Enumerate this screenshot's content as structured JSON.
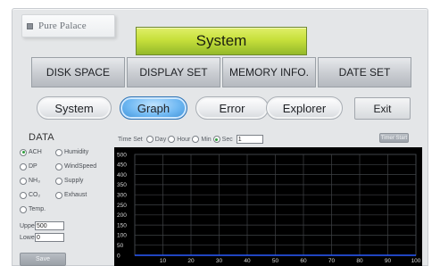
{
  "brand": {
    "name": "Pure Palace"
  },
  "title": "System",
  "tabs": [
    {
      "label": "DISK SPACE"
    },
    {
      "label": "DISPLAY SET"
    },
    {
      "label": "MEMORY INFO."
    },
    {
      "label": "DATE SET"
    }
  ],
  "pills": [
    {
      "label": "System",
      "active": false
    },
    {
      "label": "Graph",
      "active": true
    },
    {
      "label": "Error",
      "active": false
    },
    {
      "label": "Explorer",
      "active": false
    }
  ],
  "exit_label": "Exit",
  "data_panel": {
    "heading": "DATA",
    "options": [
      [
        "ACH",
        "Humidity"
      ],
      [
        "DP",
        "WindSpeed"
      ],
      [
        "NH₃",
        "Supply"
      ],
      [
        "CO₂",
        "Exhaust"
      ],
      [
        "Temp.",
        ""
      ]
    ],
    "selected": "ACH",
    "upper_label": "Upper",
    "upper_value": "500",
    "lower_label": "Lower",
    "lower_value": "0",
    "save_label": "Save"
  },
  "time_set": {
    "label": "Time Set",
    "options": [
      "Day",
      "Hour",
      "Min",
      "Sec"
    ],
    "selected": "Sec",
    "value": "1"
  },
  "timer_button": "Timer Start",
  "accent_colors": {
    "title_bar": "#c7e03b",
    "active_pill": "#6fb8f2",
    "radio_selected": "#2e9e3c",
    "plot_bg": "#000000",
    "series": "#2a5cff"
  },
  "chart_data": {
    "type": "line",
    "title": "",
    "xlabel": "",
    "ylabel": "",
    "xlim": [
      0,
      100
    ],
    "ylim": [
      0,
      500
    ],
    "x_ticks": [
      0,
      10,
      20,
      30,
      40,
      50,
      60,
      70,
      80,
      90,
      100
    ],
    "x_tick_labels": [
      "10",
      "20",
      "30",
      "40",
      "50",
      "60",
      "70",
      "80",
      "90",
      "100"
    ],
    "y_ticks": [
      0,
      50,
      100,
      150,
      200,
      250,
      300,
      350,
      400,
      450,
      500
    ],
    "grid": true,
    "series": [
      {
        "x": [
          0,
          100
        ],
        "y": [
          0,
          0
        ]
      }
    ]
  }
}
